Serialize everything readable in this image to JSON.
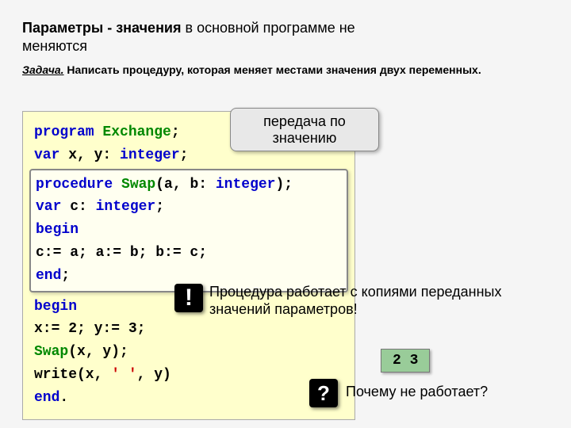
{
  "title": {
    "strong1": "Параметры - значения",
    "light1": " в основной программе не",
    "line2": "меняются"
  },
  "task": {
    "label": "Задача.",
    "text": " Написать процедуру, которая меняет местами значения двух переменных."
  },
  "code": {
    "l1_kw": "program",
    "l1_name": " Exchange",
    "l1_end": ";",
    "l2_kw": "var",
    "l2_mid": " x, y: ",
    "l2_type": "integer",
    "l2_end": ";",
    "p1_kw": "procedure",
    "p1_name": " Swap",
    "p1_args": "(a, b: ",
    "p1_type": "integer",
    "p1_end": ");",
    "p2_kw": "var",
    "p2_mid": " c: ",
    "p2_type": "integer",
    "p2_end": ";",
    "p3_kw": "begin",
    "p4": "  c:= a; a:= b; b:= c;",
    "p5_kw": "end",
    "p5_end": ";",
    "m1_kw": "begin",
    "m2": "  x:= 2; y:= 3;",
    "m3a": "  ",
    "m3b": "Swap",
    "m3c": "(x, y);",
    "m4a": "  write(x, ",
    "m4str": "' '",
    "m4b": ", y)",
    "m5_kw": "end",
    "m5_end": "."
  },
  "callout1": "передача по значению",
  "bang": "!",
  "note1": "Процедура работает с копиями переданных значений параметров!",
  "output": "2 3",
  "qmark": "?",
  "note2": "Почему не работает?"
}
